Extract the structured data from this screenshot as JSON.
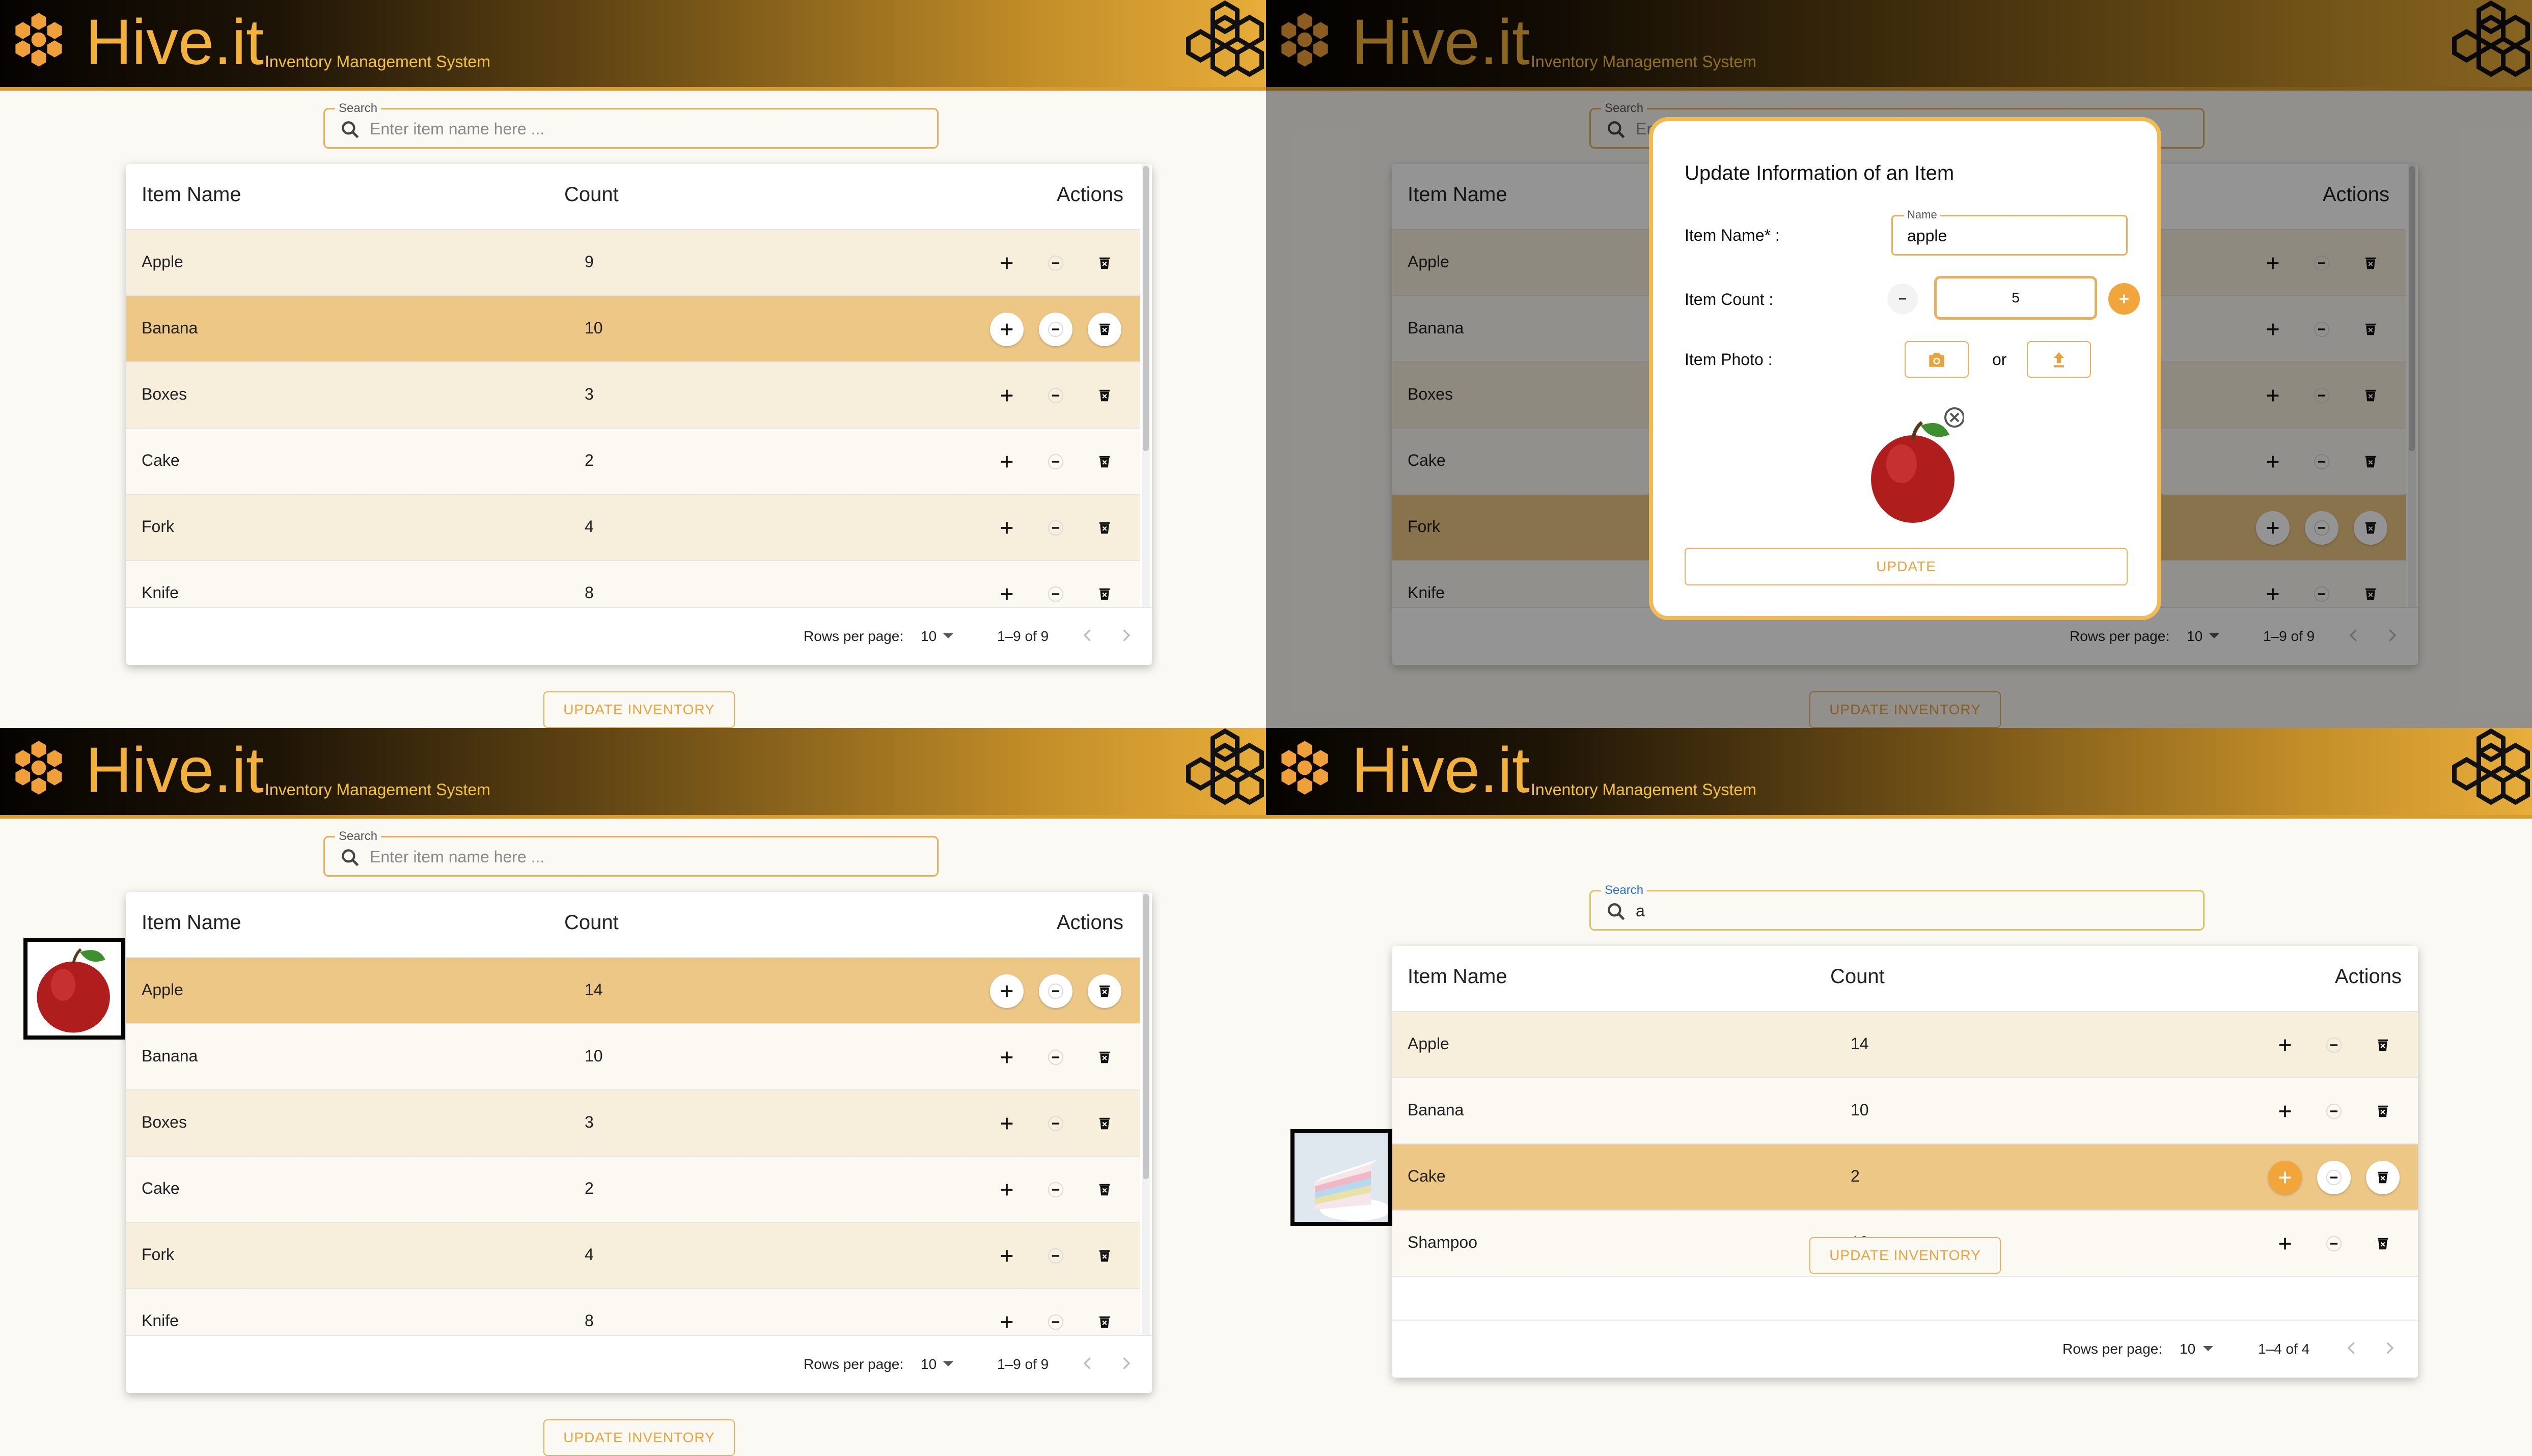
{
  "brand": {
    "name": "Hive.it",
    "subtitle": "Inventory Management System"
  },
  "search": {
    "label": "Search",
    "placeholder": "Enter item name here ..."
  },
  "table": {
    "col_name": "Item Name",
    "col_count": "Count",
    "col_actions": "Actions"
  },
  "pagination": {
    "rows_per_page_label": "Rows per page:",
    "rows_per_page": "10"
  },
  "update_inventory_label": "UPDATE INVENTORY",
  "colors": {
    "accent": "#e8a43c",
    "selected_row": "#ecc786",
    "alt_row": "#f7eedb",
    "header_dark": "#050301",
    "header_gold": "#e8ad3a"
  },
  "icons": [
    "honeycomb-flower-icon",
    "hexagon-cluster-icon",
    "search-icon",
    "plus-icon",
    "minus-icon",
    "trash-icon",
    "chevron-left-icon",
    "chevron-right-icon",
    "camera-icon",
    "upload-icon",
    "close-icon"
  ],
  "screens": [
    {
      "search_value": "",
      "range": "1–9 of 9",
      "rows": [
        {
          "name": "Apple",
          "count": "9"
        },
        {
          "name": "Banana",
          "count": "10"
        },
        {
          "name": "Boxes",
          "count": "3"
        },
        {
          "name": "Cake",
          "count": "2"
        },
        {
          "name": "Fork",
          "count": "4"
        },
        {
          "name": "Knife",
          "count": "8"
        }
      ]
    },
    {
      "search_value": "",
      "range": "1–9 of 9",
      "rows": [
        {
          "name": "Apple",
          "count": ""
        },
        {
          "name": "Banana",
          "count": ""
        },
        {
          "name": "Boxes",
          "count": ""
        },
        {
          "name": "Cake",
          "count": ""
        },
        {
          "name": "Fork",
          "count": ""
        },
        {
          "name": "Knife",
          "count": ""
        }
      ]
    },
    {
      "search_value": "",
      "range": "1–9 of 9",
      "rows": [
        {
          "name": "Apple",
          "count": "14"
        },
        {
          "name": "Banana",
          "count": "10"
        },
        {
          "name": "Boxes",
          "count": "3"
        },
        {
          "name": "Cake",
          "count": "2"
        },
        {
          "name": "Fork",
          "count": "4"
        },
        {
          "name": "Knife",
          "count": "8"
        }
      ]
    },
    {
      "search_value": "a",
      "range": "1–4 of 4",
      "rows": [
        {
          "name": "Apple",
          "count": "14"
        },
        {
          "name": "Banana",
          "count": "10"
        },
        {
          "name": "Cake",
          "count": "2"
        },
        {
          "name": "Shampoo",
          "count": "19"
        }
      ]
    }
  ],
  "modal": {
    "title": "Update Information of an Item",
    "name_label": "Item Name* :",
    "name_field_label": "Name",
    "name_value": "apple",
    "count_label": "Item Count :",
    "count_value": "5",
    "photo_label": "Item Photo :",
    "or_label": "or",
    "update_label": "UPDATE"
  }
}
